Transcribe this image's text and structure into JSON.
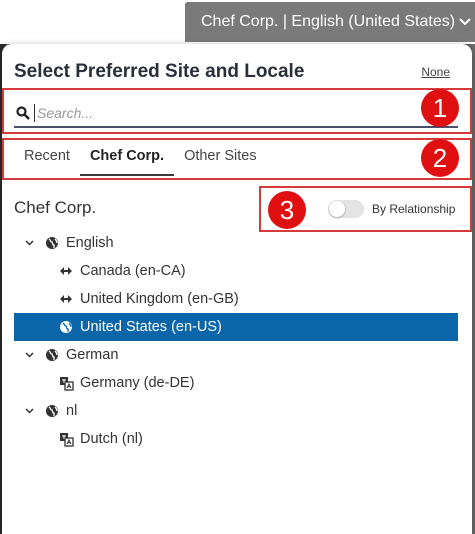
{
  "site_selector": {
    "label": "Chef Corp. | English (United States)"
  },
  "panel": {
    "title": "Select Preferred Site and Locale",
    "none_link": "None"
  },
  "search": {
    "placeholder": "Search..."
  },
  "tabs": [
    {
      "label": "Recent",
      "active": false
    },
    {
      "label": "Chef Corp.",
      "active": true
    },
    {
      "label": "Other Sites",
      "active": false
    }
  ],
  "section_title": "Chef Corp.",
  "toggle": {
    "label": "By Relationship",
    "on": false
  },
  "callouts": [
    "1",
    "2",
    "3"
  ],
  "tree": [
    {
      "label": "English",
      "icon": "globe-icon",
      "expanded": true
    },
    {
      "label": "Canada (en-CA)",
      "icon": "arrows-icon"
    },
    {
      "label": "United Kingdom (en-GB)",
      "icon": "arrows-icon"
    },
    {
      "label": "United States (en-US)",
      "icon": "globe-icon",
      "selected": true
    },
    {
      "label": "German",
      "icon": "globe-icon",
      "expanded": true
    },
    {
      "label": "Germany (de-DE)",
      "icon": "translate-icon"
    },
    {
      "label": "nl",
      "icon": "globe-icon",
      "expanded": true
    },
    {
      "label": "Dutch (nl)",
      "icon": "translate-icon"
    }
  ],
  "colors": {
    "accent": "#0a66a8",
    "callout": "#e01010",
    "outline": "#d63a3a"
  }
}
